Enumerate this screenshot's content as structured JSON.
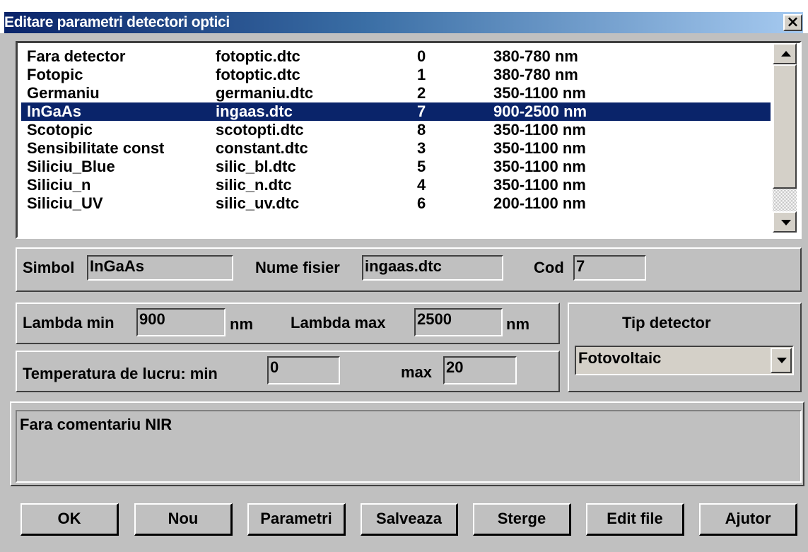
{
  "window": {
    "title": "Editare parametri detectori optici",
    "close_glyph": "×"
  },
  "detector_list": {
    "rows": [
      {
        "name": "Fara detector",
        "file": "fotoptic.dtc",
        "code": "0",
        "range": "380-780 nm"
      },
      {
        "name": "Fotopic",
        "file": "fotoptic.dtc",
        "code": "1",
        "range": "380-780 nm"
      },
      {
        "name": "Germaniu",
        "file": "germaniu.dtc",
        "code": "2",
        "range": "350-1100 nm"
      },
      {
        "name": "InGaAs",
        "file": "ingaas.dtc",
        "code": "7",
        "range": "900-2500 nm"
      },
      {
        "name": "Scotopic",
        "file": "scotopti.dtc",
        "code": "8",
        "range": "350-1100 nm"
      },
      {
        "name": "Sensibilitate const",
        "file": "constant.dtc",
        "code": "3",
        "range": "350-1100 nm"
      },
      {
        "name": "Siliciu_Blue",
        "file": "silic_bl.dtc",
        "code": "5",
        "range": "350-1100 nm"
      },
      {
        "name": "Siliciu_n",
        "file": "silic_n.dtc",
        "code": "4",
        "range": "350-1100 nm"
      },
      {
        "name": "Siliciu_UV",
        "file": "silic_uv.dtc",
        "code": "6",
        "range": "200-1100 nm"
      }
    ],
    "selected_index": 3
  },
  "identity": {
    "simbol_label": "Simbol",
    "simbol_value": "InGaAs",
    "file_label": "Nume fisier",
    "file_value": "ingaas.dtc",
    "cod_label": "Cod",
    "cod_value": "7"
  },
  "lambda": {
    "min_label": "Lambda min",
    "min_value": "900",
    "max_label": "Lambda max",
    "max_value": "2500",
    "unit": "nm"
  },
  "temperature": {
    "label": "Temperatura de lucru:  min",
    "min_value": "0",
    "max_label": "max",
    "max_value": "20"
  },
  "detector_type": {
    "label": "Tip detector",
    "selected": "Fotovoltaic"
  },
  "comment": "Fara comentariu NIR",
  "buttons": {
    "ok": "OK",
    "new": "Nou",
    "params": "Parametri",
    "save": "Salveaza",
    "delete": "Sterge",
    "edit_file": "Edit file",
    "help": "Ajutor"
  },
  "colors": {
    "selection": "#0a246a",
    "title_gradient_start": "#0a246a",
    "title_gradient_end": "#a6caf0",
    "face": "#c0c0c0"
  }
}
